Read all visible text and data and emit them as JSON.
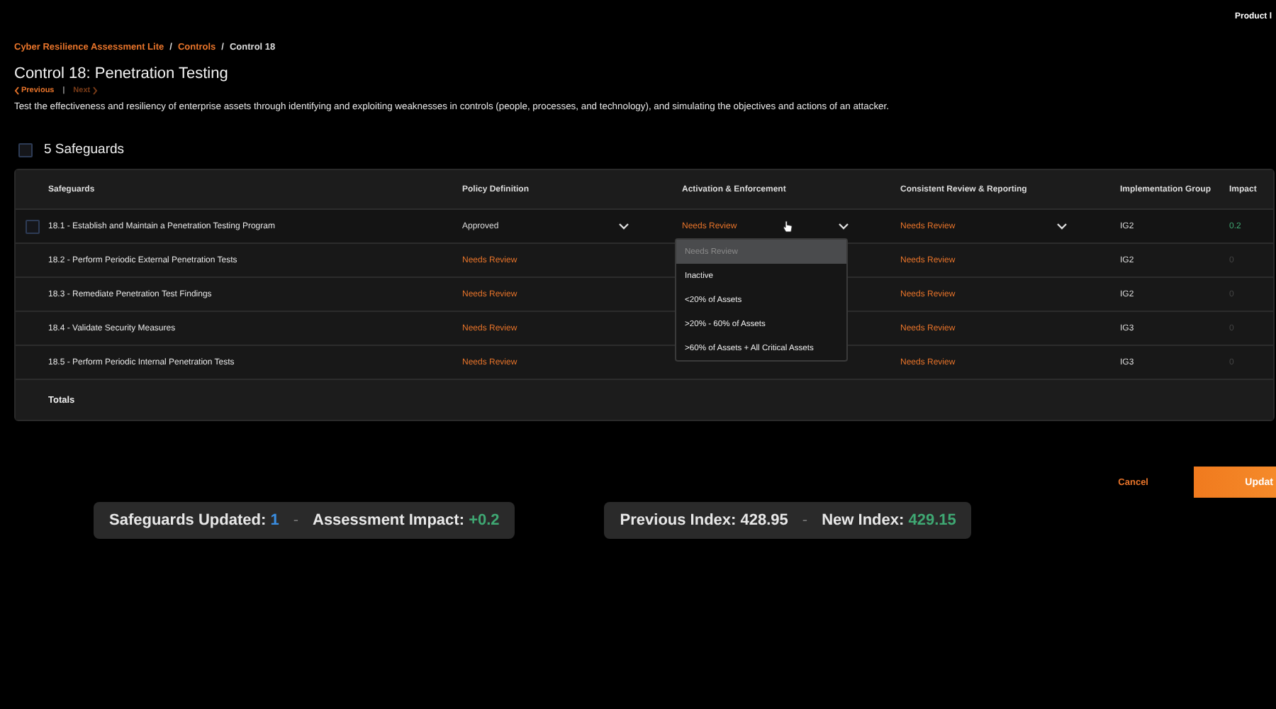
{
  "header": {
    "product_label": "Product l"
  },
  "breadcrumb": [
    {
      "label": "Cyber Resilience Assessment Lite",
      "kind": "link"
    },
    {
      "label": "Controls",
      "kind": "link"
    },
    {
      "label": "Control 18",
      "kind": "current"
    }
  ],
  "breadcrumb_separator": "/",
  "title": "Control 18: Penetration Testing",
  "pager": {
    "previous": {
      "label": "Previous",
      "disabled": false
    },
    "separator": "|",
    "next": {
      "label": "Next",
      "disabled": true
    }
  },
  "description": "Test the effectiveness and resiliency of enterprise assets through identifying and exploiting weaknesses in controls (people, processes, and technology), and simulating the objectives and actions of an attacker.",
  "select_all": {
    "label": "5 Safeguards",
    "checked": false
  },
  "table": {
    "columns": [
      "Safeguards",
      "Policy Definition",
      "Activation & Enforcement",
      "Consistent Review & Reporting",
      "Implementation Group",
      "Impact"
    ],
    "rows": [
      {
        "checked": false,
        "safeguard": "18.1 - Establish and Maintain a Penetration Testing Program",
        "policy": {
          "text": "Approved",
          "kind": "approved",
          "dropdown": true
        },
        "activation": {
          "text": "Needs Review",
          "kind": "needs_review",
          "dropdown": true
        },
        "review": {
          "text": "Needs Review",
          "kind": "needs_review",
          "dropdown": true
        },
        "group": "IG2",
        "impact": {
          "text": "0.2",
          "kind": "positive"
        }
      },
      {
        "safeguard": "18.2 - Perform Periodic External Penetration Tests",
        "policy": {
          "text": "Needs Review",
          "kind": "needs_review",
          "dropdown": false
        },
        "review": {
          "text": "Needs Review",
          "kind": "needs_review",
          "dropdown": false
        },
        "group": "IG2",
        "impact": {
          "text": "0",
          "kind": "zero"
        }
      },
      {
        "safeguard": "18.3 - Remediate Penetration Test Findings",
        "policy": {
          "text": "Needs Review",
          "kind": "needs_review",
          "dropdown": false
        },
        "review": {
          "text": "Needs Review",
          "kind": "needs_review",
          "dropdown": false
        },
        "group": "IG2",
        "impact": {
          "text": "0",
          "kind": "zero"
        }
      },
      {
        "safeguard": "18.4 - Validate Security Measures",
        "policy": {
          "text": "Needs Review",
          "kind": "needs_review",
          "dropdown": false
        },
        "review": {
          "text": "Needs Review",
          "kind": "needs_review",
          "dropdown": false
        },
        "group": "IG3",
        "impact": {
          "text": "0",
          "kind": "zero"
        }
      },
      {
        "safeguard": "18.5 - Perform Periodic Internal Penetration Tests",
        "policy": {
          "text": "Needs Review",
          "kind": "needs_review",
          "dropdown": false
        },
        "review": {
          "text": "Needs Review",
          "kind": "needs_review",
          "dropdown": false
        },
        "group": "IG3",
        "impact": {
          "text": "0",
          "kind": "zero"
        }
      }
    ],
    "totals_label": "Totals"
  },
  "dropdown_menu": {
    "options": [
      {
        "label": "Needs Review",
        "selected": true
      },
      {
        "label": "Inactive",
        "selected": false
      },
      {
        "label": "<20% of Assets",
        "selected": false
      },
      {
        "label": ">20% - 60% of Assets",
        "selected": false
      },
      {
        "label": ">60% of Assets + All Critical Assets",
        "selected": false
      }
    ]
  },
  "actions": {
    "cancel": "Cancel",
    "update": "Updat"
  },
  "summaries": [
    {
      "items": [
        {
          "label": "Safeguards Updated:",
          "value": "1",
          "kind": "count"
        },
        {
          "label": "Assessment Impact:",
          "value": "+0.2",
          "kind": "positive"
        }
      ]
    },
    {
      "items": [
        {
          "label": "Previous Index:",
          "value": "428.95",
          "kind": "plain"
        },
        {
          "label": "New Index:",
          "value": "429.15",
          "kind": "positive"
        }
      ]
    }
  ],
  "summary_separator": "-"
}
